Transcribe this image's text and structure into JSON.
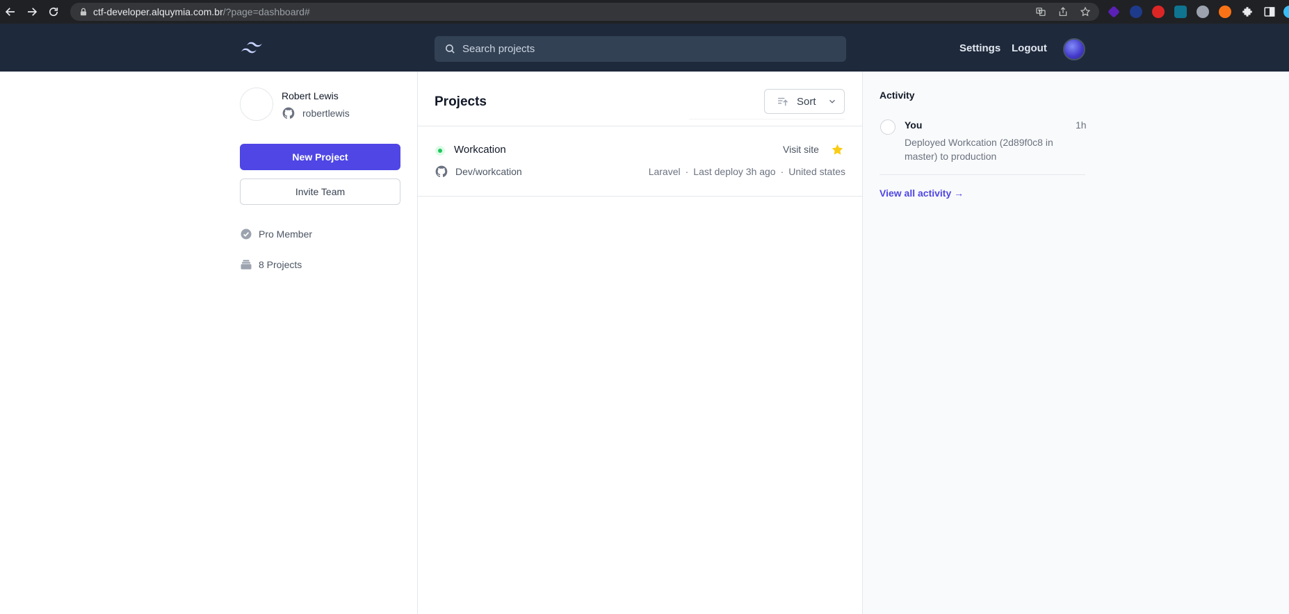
{
  "browser": {
    "url_host": "ctf-developer.alquymia.com.br",
    "url_path": "/?page=dashboard#",
    "icons": [
      "back-icon",
      "forward-icon",
      "reload-icon",
      "lock-icon",
      "translate-icon",
      "share-icon",
      "bookmark-star-icon",
      "extensions-icon",
      "side-panel-icon"
    ]
  },
  "header": {
    "search_placeholder": "Search projects",
    "settings_label": "Settings",
    "logout_label": "Logout"
  },
  "profile": {
    "name": "Robert Lewis",
    "handle": "robertlewis"
  },
  "sidebar": {
    "new_project_label": "New Project",
    "invite_team_label": "Invite Team",
    "membership": "Pro Member",
    "projects_count": "8 Projects"
  },
  "projects": {
    "title": "Projects",
    "sort_label": "Sort",
    "items": [
      {
        "name": "Workcation",
        "visit_label": "Visit site",
        "repo": "Dev/workcation",
        "framework": "Laravel",
        "last_deploy": "Last deploy 3h ago",
        "location": "United states",
        "separator": "·",
        "starred": true,
        "status": "active"
      }
    ]
  },
  "activity": {
    "title": "Activity",
    "items": [
      {
        "user": "You",
        "time": "1h",
        "description": "Deployed Workcation (2d89f0c8 in master) to production"
      }
    ],
    "view_all_label": "View all activity →"
  },
  "colors": {
    "header_bg": "#1e293b",
    "accent": "#4f46e5",
    "status_active": "#22c55e",
    "star": "#facc15"
  }
}
